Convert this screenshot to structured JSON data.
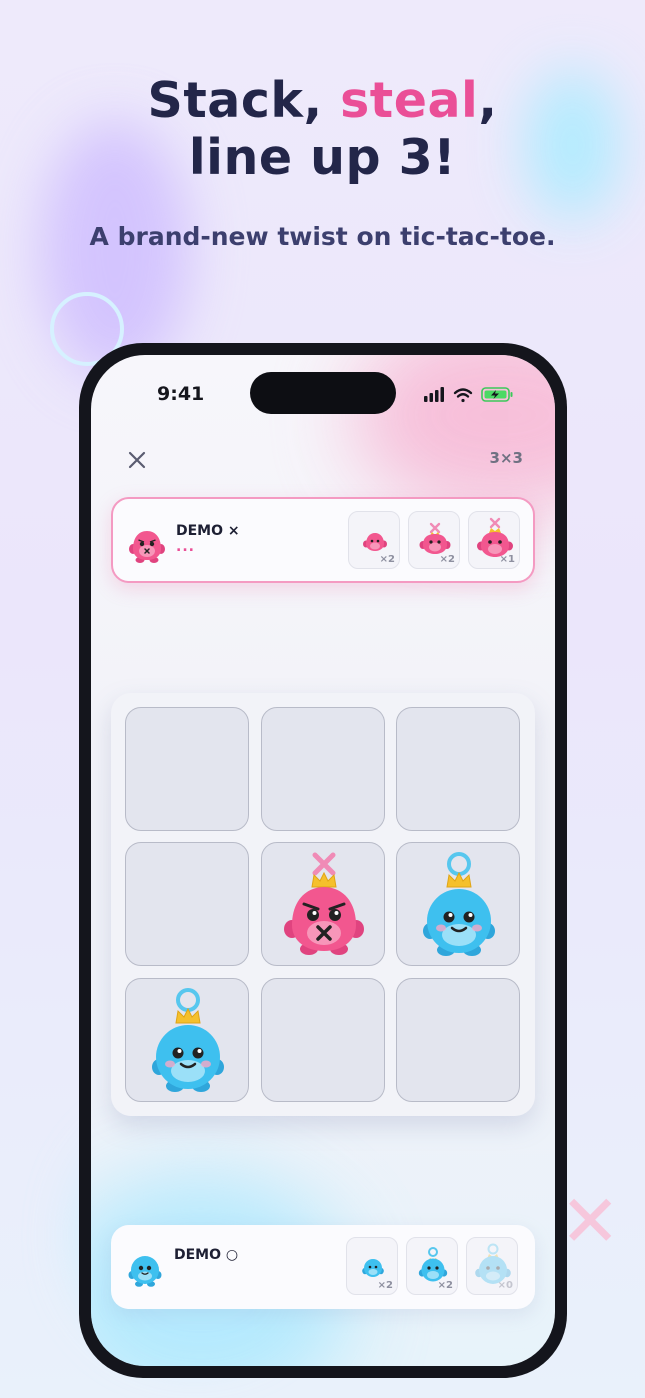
{
  "promo": {
    "headline_part1": "Stack, ",
    "headline_highlight": "steal",
    "headline_part2": ",",
    "headline_line2": "line up 3!",
    "subtitle": "A brand-new twist on tic-tac-toe."
  },
  "status_bar": {
    "time": "9:41"
  },
  "header": {
    "grid_size": "3×3"
  },
  "players": {
    "top": {
      "name": "DEMO ×",
      "turn_indicator": "...",
      "pieces": [
        {
          "size": "small",
          "count": "×2",
          "state": "available"
        },
        {
          "size": "medium",
          "count": "×2",
          "state": "available"
        },
        {
          "size": "large",
          "count": "×1",
          "state": "available"
        }
      ]
    },
    "bottom": {
      "name": "DEMO ○",
      "pieces": [
        {
          "size": "small",
          "count": "×2",
          "state": "available"
        },
        {
          "size": "medium",
          "count": "×2",
          "state": "available"
        },
        {
          "size": "large",
          "count": "×0",
          "state": "used-up"
        }
      ]
    }
  },
  "board": {
    "size": 3,
    "cells": [
      {
        "row": 1,
        "col": 1,
        "piece": null
      },
      {
        "row": 1,
        "col": 2,
        "piece": null
      },
      {
        "row": 1,
        "col": 3,
        "piece": null
      },
      {
        "row": 2,
        "col": 1,
        "piece": null
      },
      {
        "row": 2,
        "col": 2,
        "piece": {
          "player": "x",
          "size": "large",
          "character": "pink-x-monster-icon"
        }
      },
      {
        "row": 2,
        "col": 3,
        "piece": {
          "player": "o",
          "size": "large",
          "character": "blue-o-monster-icon"
        }
      },
      {
        "row": 3,
        "col": 1,
        "piece": {
          "player": "o",
          "size": "large",
          "character": "blue-o-monster-icon"
        }
      },
      {
        "row": 3,
        "col": 2,
        "piece": null
      },
      {
        "row": 3,
        "col": 3,
        "piece": null
      }
    ]
  },
  "colors": {
    "x_player": "#ea4f97",
    "o_player": "#3ec0ef",
    "highlight_text": "#ea4f97",
    "headline_text": "#232649",
    "crown": "#f5c02c"
  }
}
